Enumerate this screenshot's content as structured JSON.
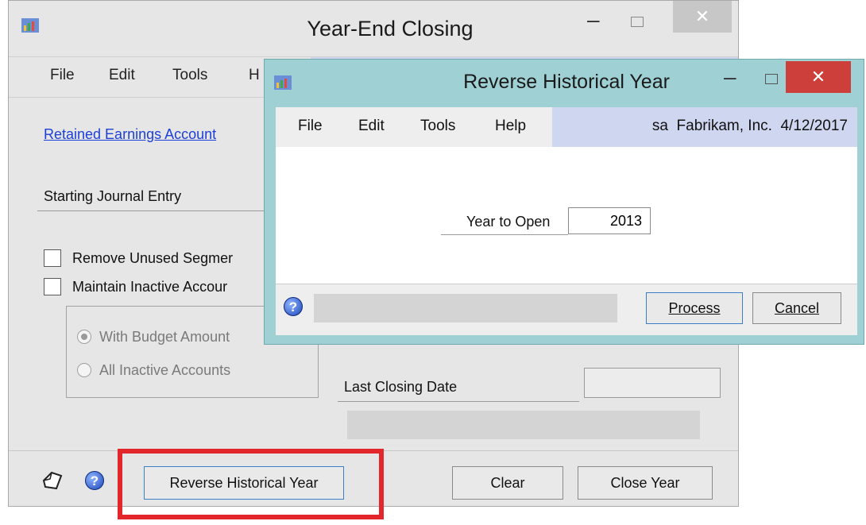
{
  "back_window": {
    "title": "Year-End Closing",
    "menu": [
      "File",
      "Edit",
      "Tools",
      "H"
    ],
    "retained_earnings_link": "Retained Earnings Account",
    "starting_journal_entry_label": "Starting Journal Entry",
    "remove_unused_segments": "Remove Unused Segmer",
    "maintain_inactive_accounts": "Maintain Inactive Accour",
    "radio_with_budget": "With Budget Amount",
    "radio_all_inactive": "All Inactive Accounts",
    "last_closing_date_label": "Last Closing Date",
    "last_closing_date_value": "",
    "buttons": {
      "reverse_historical_year": "Reverse Historical Year",
      "clear": "Clear",
      "close_year": "Close Year"
    }
  },
  "front_window": {
    "title": "Reverse Historical Year",
    "menu": [
      "File",
      "Edit",
      "Tools",
      "Help"
    ],
    "user_info": "sa  Fabrikam, Inc.  4/12/2017",
    "year_to_open_label": "Year to Open",
    "year_to_open_value": "2013",
    "buttons": {
      "process": "Process",
      "cancel": "Cancel"
    }
  },
  "icons": {
    "app": "app-icon",
    "help": "help-icon",
    "note": "note-icon",
    "close": "close-icon",
    "minimize": "minimize-icon",
    "maximize": "maximize-icon"
  },
  "colors": {
    "highlight": "#e3262b",
    "front_titlebar": "#9fd0d4",
    "close_active": "#cc3f3a",
    "link": "#1c3fd8"
  }
}
